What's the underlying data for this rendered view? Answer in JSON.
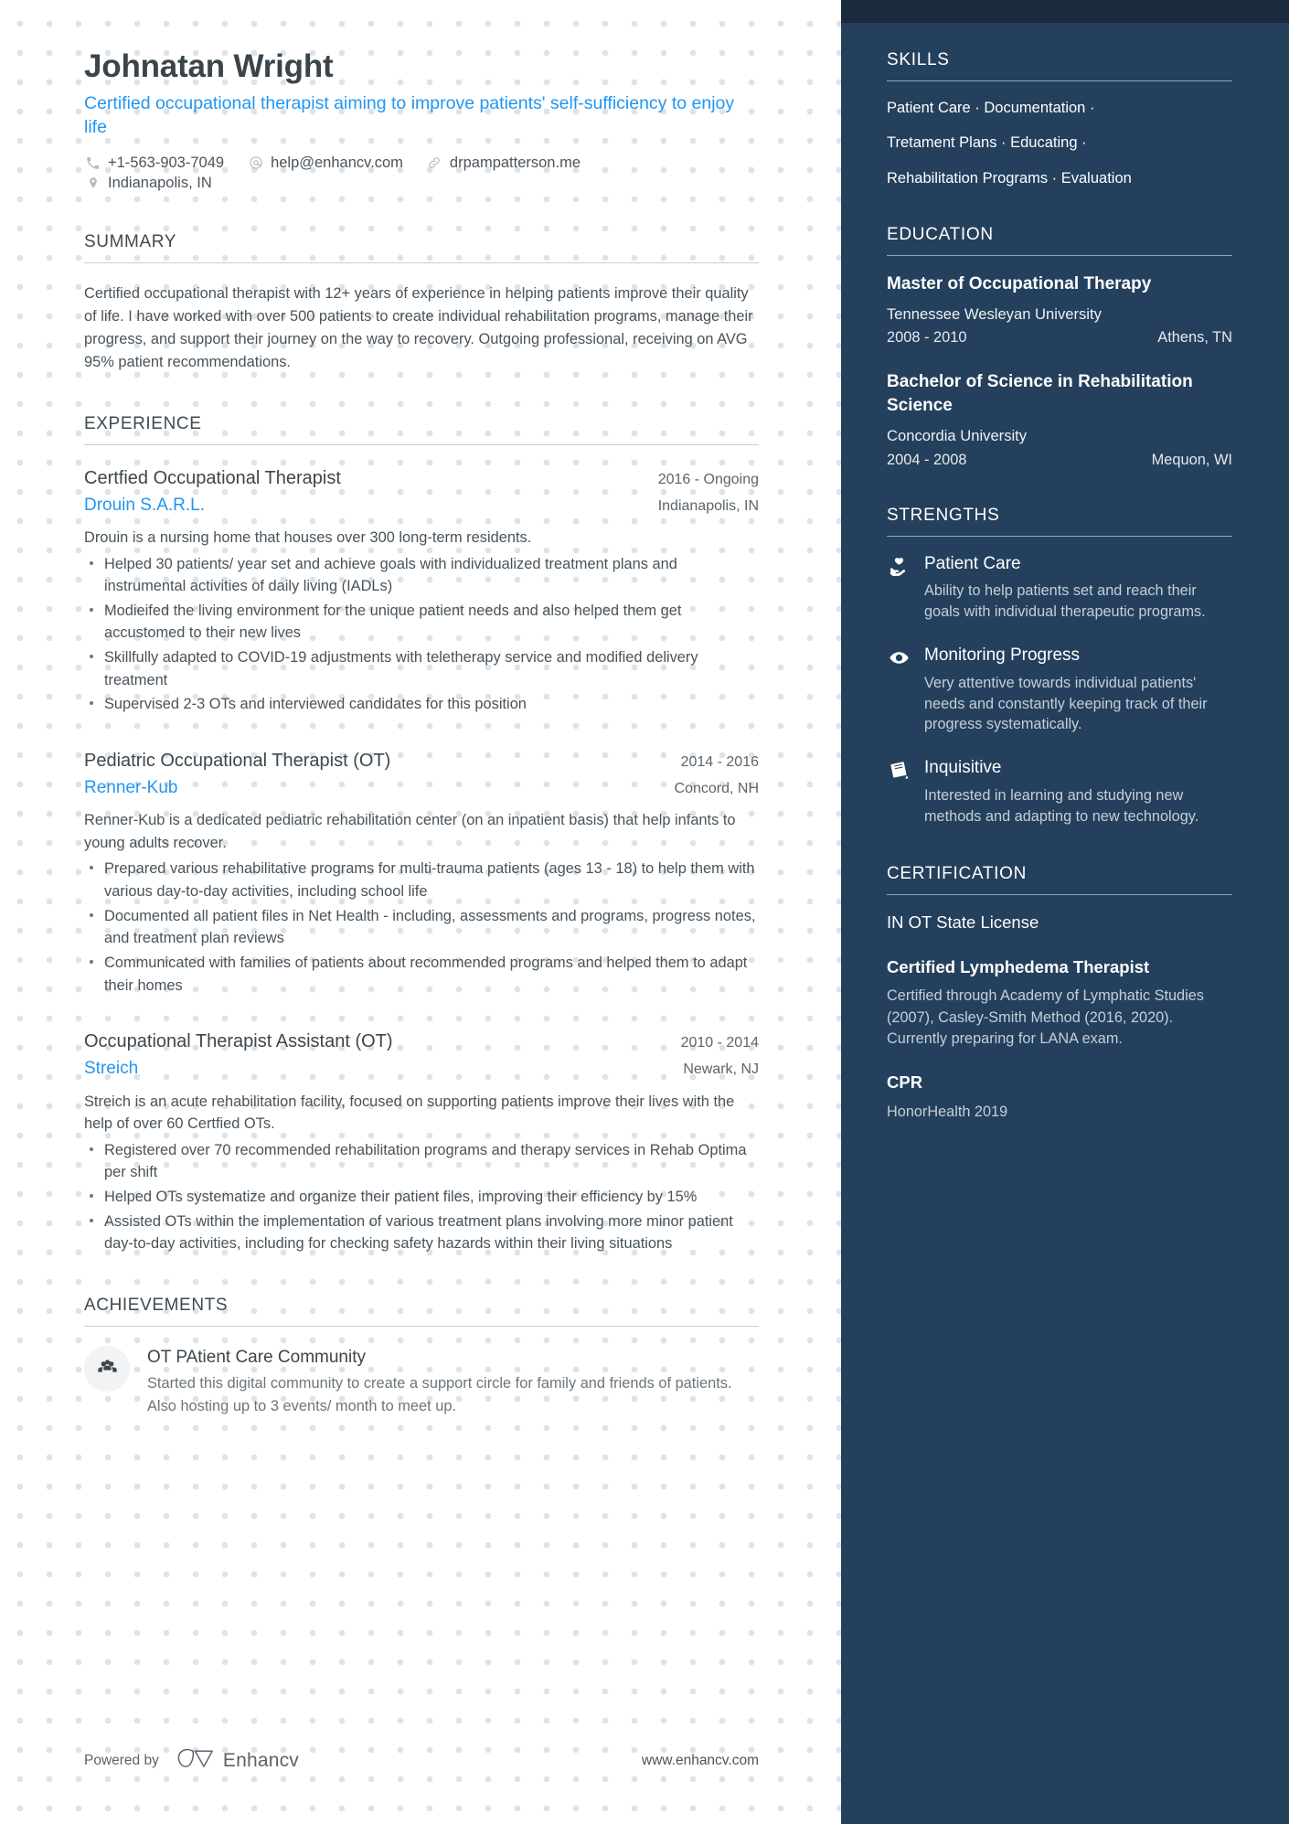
{
  "header": {
    "name": "Johnatan Wright",
    "headline": "Certified occupational therapist aiming to improve patients' self-sufficiency to enjoy life",
    "contacts": [
      {
        "icon": "phone-icon",
        "value": "+1-563-903-7049"
      },
      {
        "icon": "email-icon",
        "value": "help@enhancv.com"
      },
      {
        "icon": "link-icon",
        "value": "drpampatterson.me"
      }
    ],
    "location": {
      "icon": "map-pin-icon",
      "value": "Indianapolis, IN"
    }
  },
  "summary": {
    "title": "SUMMARY",
    "text": "Certified occupational therapist with 12+ years of experience in helping patients improve their quality of life. I have worked with over 500 patients to create individual rehabilitation programs, manage their progress, and support their journey on the way to recovery. Outgoing professional, receiving on AVG 95% patient recommendations."
  },
  "experience": {
    "title": "EXPERIENCE",
    "jobs": [
      {
        "title": "Certfied Occupational Therapist",
        "dates": "2016 - Ongoing",
        "company": "Drouin S.A.R.L.",
        "location": "Indianapolis, IN",
        "description": "Drouin is a nursing home that houses over 300 long-term residents.",
        "bullets": [
          "Helped 30 patients/ year set and achieve goals with individualized treatment plans and instrumental activities of daily living (IADLs)",
          "Modieifed the living environment for the unique patient needs and also helped them get accustomed to their new lives",
          "Skillfully adapted to COVID-19 adjustments with teletherapy service and modified delivery treatment",
          "Supervised 2-3 OTs and interviewed candidates for this position"
        ]
      },
      {
        "title": "Pediatric Occupational Therapist (OT)",
        "dates": "2014 - 2016",
        "company": "Renner-Kub",
        "location": "Concord, NH",
        "description": "Renner-Kub is a dedicated pediatric rehabilitation center (on an inpatient basis) that help infants to young adults recover.",
        "bullets": [
          "Prepared various rehabilitative programs for multi-trauma patients (ages 13 - 18) to help them with various day-to-day activities, including school life",
          "Documented all patient files in Net Health - including, assessments and programs, progress notes, and treatment plan reviews",
          "Communicated with families of patients about recommended programs and helped them to adapt their homes"
        ]
      },
      {
        "title": "Occupational Therapist Assistant (OT)",
        "dates": "2010 - 2014",
        "company": "Streich",
        "location": "Newark, NJ",
        "description": "Streich is an acute rehabilitation facility, focused on supporting patients improve their lives with the help of over 60 Certfied OTs.",
        "bullets": [
          "Registered over 70 recommended rehabilitation programs and therapy services in Rehab Optima per shift",
          "Helped OTs systematize and organize their patient files, improving their efficiency by 15%",
          "Assisted OTs within the implementation of various treatment plans involving more minor patient day-to-day activities, including for checking safety hazards within their living situations"
        ]
      }
    ]
  },
  "achievements": {
    "title": "ACHIEVEMENTS",
    "items": [
      {
        "icon": "people-group-icon",
        "title": "OT PAtient Care Community",
        "description": "Started this digital community to create a support circle for family and friends of patients. Also hosting up to 3 events/ month to meet up."
      }
    ]
  },
  "footer": {
    "powered_by": "Powered by",
    "brand": "Enhancv",
    "brand_icon": "enhancv-logo-icon",
    "url": "www.enhancv.com"
  },
  "sidebar": {
    "skills": {
      "title": "SKILLS",
      "lines": [
        "Patient Care · Documentation ·",
        "Tretament Plans · Educating ·",
        "Rehabilitation Programs · Evaluation"
      ]
    },
    "education": {
      "title": "EDUCATION",
      "items": [
        {
          "degree": "Master of Occupational Therapy",
          "school": "Tennessee Wesleyan University",
          "dates": "2008 - 2010",
          "location": "Athens, TN"
        },
        {
          "degree": "Bachelor of Science in Rehabilitation Science",
          "school": "Concordia University",
          "dates": "2004 - 2008",
          "location": "Mequon, WI"
        }
      ]
    },
    "strengths": {
      "title": "STRENGTHS",
      "items": [
        {
          "icon": "hand-holding-heart-icon",
          "title": "Patient Care",
          "description": "Ability to help patients set and reach their goals with individual therapeutic programs."
        },
        {
          "icon": "eye-icon",
          "title": "Monitoring Progress",
          "description": "Very attentive towards individual patients' needs and constantly keeping track of their progress systematically."
        },
        {
          "icon": "book-icon",
          "title": "Inquisitive",
          "description": "Interested in learning and studying new methods and adapting to new technology."
        }
      ]
    },
    "certification": {
      "title": "CERTIFICATION",
      "items": [
        {
          "name": "IN OT State License",
          "bold": false,
          "description": ""
        },
        {
          "name": "Certified Lymphedema Therapist",
          "bold": true,
          "description": "Certified through Academy of Lymphatic Studies (2007), Casley-Smith Method (2016, 2020). Currently preparing for LANA exam."
        },
        {
          "name": "CPR",
          "bold": true,
          "description": "HonorHealth 2019"
        }
      ]
    }
  },
  "colors": {
    "accent_blue": "#2196f3",
    "sidebar_bg": "#24405c",
    "sidebar_topbar": "#1b2b3d",
    "text_dark": "#3c464d"
  }
}
